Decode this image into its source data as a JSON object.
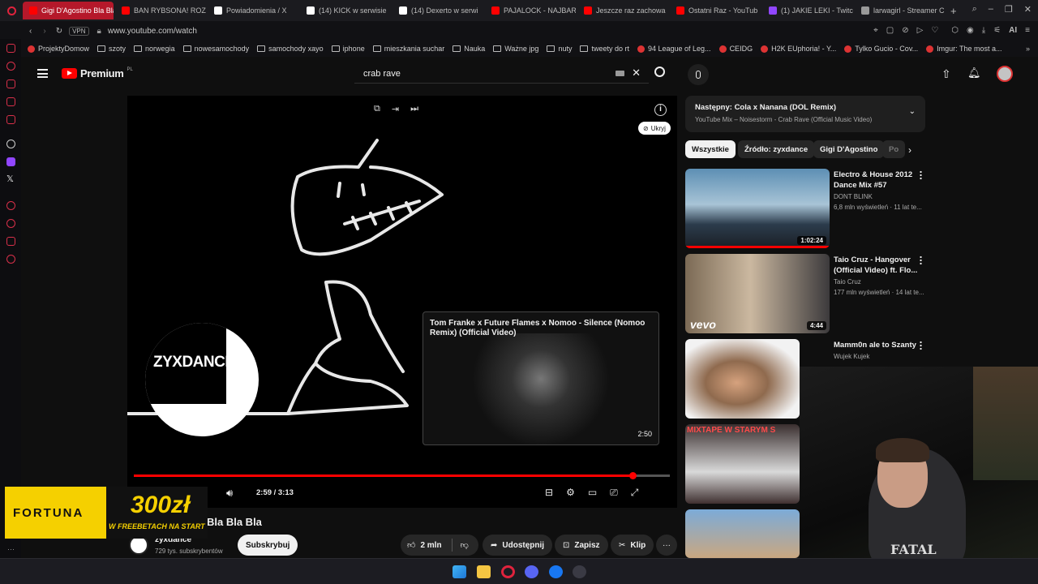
{
  "tabs": [
    {
      "label": "Gigi D'Agostino Bla Bla",
      "active": true,
      "color": "#ff0000"
    },
    {
      "label": "BAN RYBSONA! ROZ",
      "color": "#ff0000"
    },
    {
      "label": "Powiadomienia / X",
      "color": "#ffffff"
    },
    {
      "label": "(14) KICK w serwisie",
      "color": "#ffffff"
    },
    {
      "label": "(14) Dexerto w serwi",
      "color": "#ffffff"
    },
    {
      "label": "PAJALOCK - NAJBAR",
      "color": "#ff0000"
    },
    {
      "label": "Jeszcze raz zachowa",
      "color": "#ff0000"
    },
    {
      "label": "Ostatni Raz - YouTub",
      "color": "#ff0000"
    },
    {
      "label": "(1) JAKIE LEKI - Twitc",
      "color": "#9146ff"
    },
    {
      "label": "larwagirl - Streamer C",
      "color": "#9a9a9a"
    }
  ],
  "address": {
    "vpn": "VPN",
    "url": "www.youtube.com/watch",
    "ai": "AI"
  },
  "bookmarks": [
    {
      "label": "ProjektyDomow",
      "folder": false
    },
    {
      "label": "szoty",
      "folder": true
    },
    {
      "label": "norwegia",
      "folder": true
    },
    {
      "label": "nowesamochody",
      "folder": true
    },
    {
      "label": "samochody xayo",
      "folder": true
    },
    {
      "label": "iphone",
      "folder": true
    },
    {
      "label": "mieszkania suchar",
      "folder": true
    },
    {
      "label": "Nauka",
      "folder": true
    },
    {
      "label": "Ważne jpg",
      "folder": true
    },
    {
      "label": "nuty",
      "folder": true
    },
    {
      "label": "tweety do rt",
      "folder": true
    },
    {
      "label": "94 League of Leg...",
      "folder": false
    },
    {
      "label": "CEIDG",
      "folder": false
    },
    {
      "label": "H2K EUphoria! - Y...",
      "folder": false
    },
    {
      "label": "Tylko Gucio - Cov...",
      "folder": false
    },
    {
      "label": "Imgur: The most a...",
      "folder": false
    }
  ],
  "youtube": {
    "logo_text": "Premium",
    "logo_badge": "PL",
    "search_query": "crab rave"
  },
  "player": {
    "hide_label": "Ukryj",
    "channel_badge": "ZYXDANCE",
    "endcard_title": "Tom Franke x Future Flames x Nomoo - Silence (Nomoo Remix) (Official Video)",
    "endcard_duration": "2:50",
    "time": "2:59 / 3:13",
    "progress": 0.93
  },
  "below": {
    "title_fragment": "Bla Bla Bla",
    "channel_name": "zyxdance",
    "subscribers": "729 tys. subskrybentów",
    "subscribe": "Subskrybuj",
    "likes": "2 mln",
    "share": "Udostępnij",
    "save": "Zapisz",
    "clip": "Klip"
  },
  "ad": {
    "brand": "FORTUNA",
    "amount": "300zł",
    "tagline": "W FREEBETACH NA START"
  },
  "upnext": {
    "label": "Następny: Cola x Nanana (DOL Remix)",
    "sub": "YouTube Mix – Noisestorm - Crab Rave (Official Music Video)"
  },
  "chips": [
    "Wszystkie",
    "Źródło: zyxdance",
    "Gigi D'Agostino",
    "Po"
  ],
  "recommendations": [
    {
      "title": "Electro & House 2012 Dance Mix #57",
      "channel": "DONT BLINK",
      "meta": "6,8 mln wyświetleń · 11 lat te...",
      "duration": "1:02:24"
    },
    {
      "title": "Taio Cruz - Hangover (Official Video) ft. Flo...",
      "channel": "Taio Cruz",
      "meta": "177 mln wyświetleń · 14 lat te...",
      "duration": "4:44",
      "thumb_logo": "vevo"
    },
    {
      "title": "Mamm0n ale to Szanty",
      "channel": "Wujek Kujek",
      "meta": "",
      "duration": ""
    },
    {
      "title": "",
      "channel": "",
      "meta": "",
      "duration": "",
      "thumb_text": "MIXTAPE W STARYM S"
    },
    {
      "title": "",
      "channel": "",
      "meta": "",
      "duration": ""
    }
  ],
  "webcam_text": "FATAL"
}
